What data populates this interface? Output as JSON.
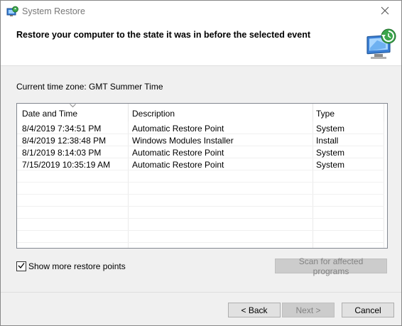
{
  "window": {
    "title": "System Restore",
    "icon": "system-restore-icon",
    "close_icon": "close-icon"
  },
  "header": {
    "heading": "Restore your computer to the state it was in before the selected event",
    "art_icon": "monitor-restore-icon"
  },
  "timezone": {
    "label": "Current time zone: GMT Summer Time"
  },
  "table": {
    "columns": [
      "Date and Time",
      "Description",
      "Type"
    ],
    "sorted_column": "Date and Time",
    "rows": [
      {
        "date": "8/4/2019 7:34:51 PM",
        "description": "Automatic Restore Point",
        "type": "System"
      },
      {
        "date": "8/4/2019 12:38:48 PM",
        "description": "Windows Modules Installer",
        "type": "Install"
      },
      {
        "date": "8/1/2019 8:14:03 PM",
        "description": "Automatic Restore Point",
        "type": "System"
      },
      {
        "date": "7/15/2019 10:35:19 AM",
        "description": "Automatic Restore Point",
        "type": "System"
      }
    ]
  },
  "options": {
    "show_more_label": "Show more restore points",
    "show_more_checked": true,
    "scan_label": "Scan for affected programs",
    "scan_enabled": false
  },
  "footer": {
    "back_label": "< Back",
    "next_label": "Next >",
    "next_enabled": false,
    "cancel_label": "Cancel"
  },
  "colors": {
    "window_bg": "#f0f0f0",
    "header_bg": "#ffffff",
    "disabled_text": "#838383",
    "button_bg": "#e1e1e1",
    "list_border": "#828790"
  }
}
